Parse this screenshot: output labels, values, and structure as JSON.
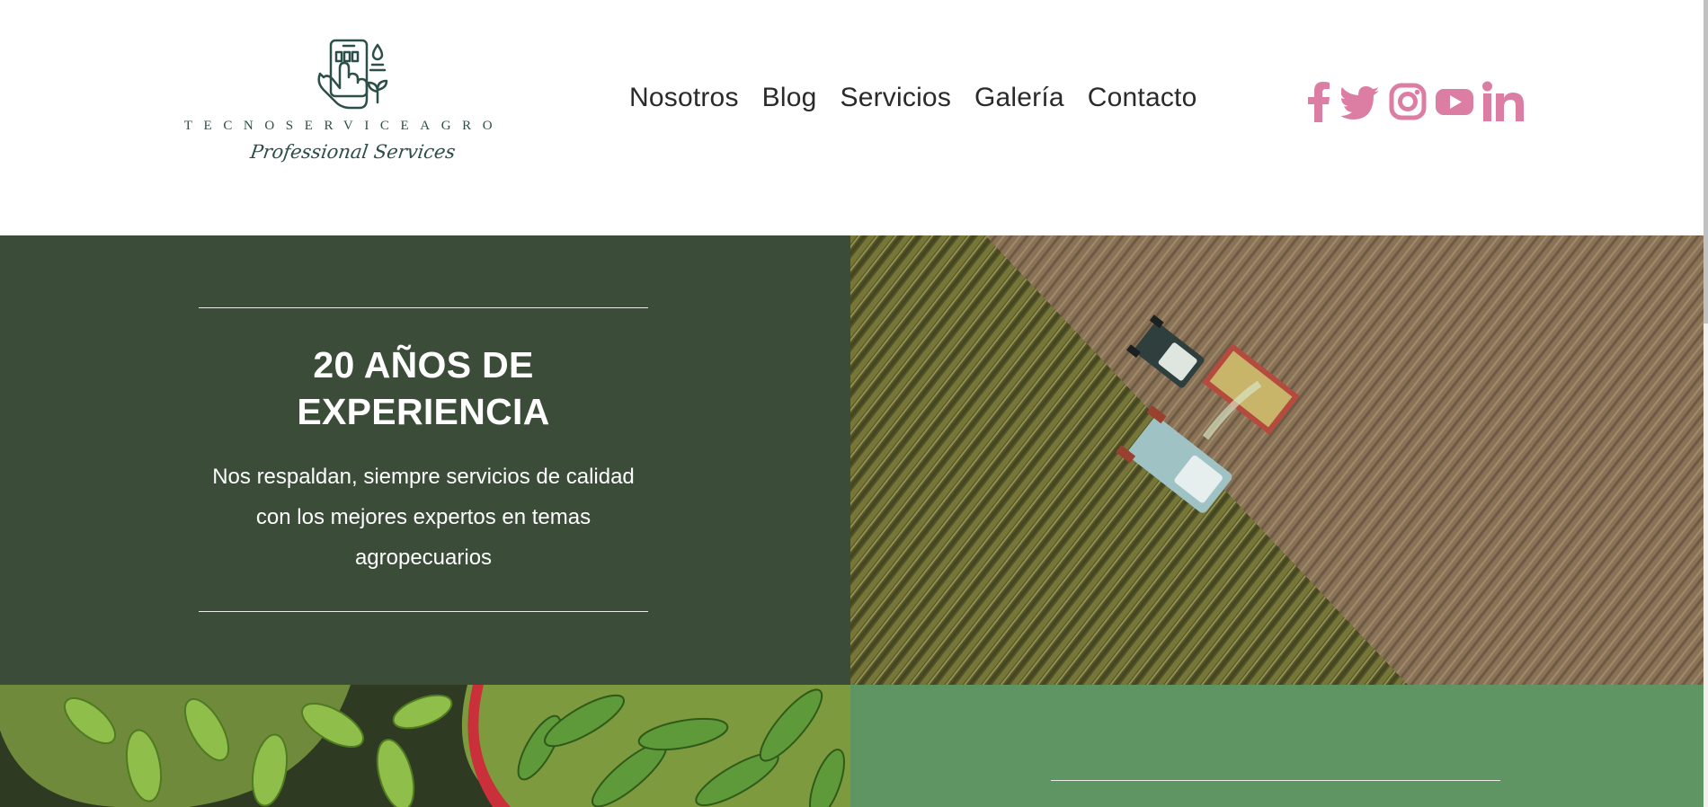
{
  "logo": {
    "wordmark": "TECNOSERVICEAGRO",
    "tagline": "Professional Services",
    "icon": "smartphone-plant-icon"
  },
  "nav": {
    "items": [
      {
        "label": "Nosotros"
      },
      {
        "label": "Blog"
      },
      {
        "label": "Servicios"
      },
      {
        "label": "Galería"
      },
      {
        "label": "Contacto"
      }
    ]
  },
  "social": {
    "color": "#dc7ea3",
    "icons": [
      "facebook-icon",
      "twitter-icon",
      "instagram-icon",
      "youtube-icon",
      "linkedin-icon"
    ]
  },
  "experience": {
    "title_line1": "20 AÑOS DE",
    "title_line2": "EXPERIENCIA",
    "text_line1": "Nos respaldan, siempre servicios de calidad",
    "text_line2": "con los mejores expertos en temas",
    "text_line3": "agropecuarios",
    "background": "#3b4d39"
  },
  "images": {
    "field": "aerial-harvest-image",
    "vegetables": "vegetables-image"
  },
  "green_panel": {
    "background": "#5e9563"
  }
}
